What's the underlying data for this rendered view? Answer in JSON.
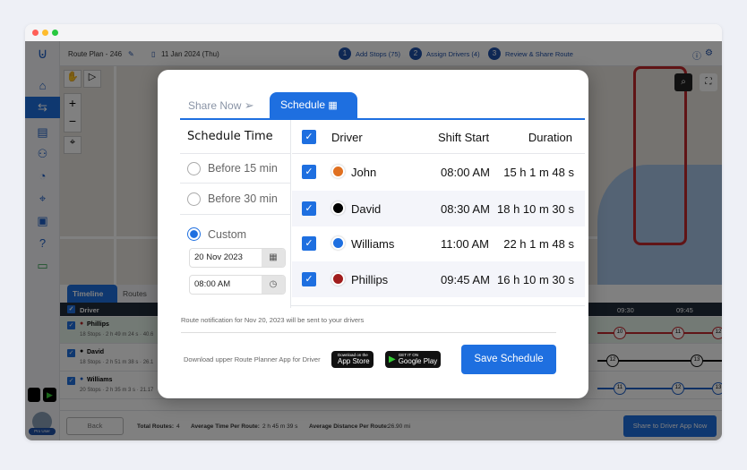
{
  "header": {
    "plan": "Route Plan - 246",
    "date": "11 Jan 2024 (Thu)",
    "steps": [
      {
        "n": "1",
        "label": "Add Stops (75)"
      },
      {
        "n": "2",
        "label": "Assign Drivers (4)"
      },
      {
        "n": "3",
        "label": "Review & Share Route"
      }
    ]
  },
  "timeline": {
    "tabs": [
      "Timeline",
      "Routes"
    ],
    "driver_header": "Driver",
    "times": [
      "09:30",
      "09:45"
    ],
    "drivers": [
      {
        "name": "Phillips",
        "color": "#b22222",
        "meta": "18 Stops · 2 h 49 m 24 s · 40.6"
      },
      {
        "name": "David",
        "color": "#000000",
        "meta": "18 Stops · 2 h 51 m 38 s · 26.1"
      },
      {
        "name": "Williams",
        "color": "#1e5fc7",
        "meta": "20 Stops · 2 h 35 m 3 s · 21.17"
      }
    ],
    "stops": [
      [
        "10",
        "11",
        "12"
      ],
      [
        "12",
        "13"
      ],
      [
        "11",
        "12",
        "13"
      ]
    ]
  },
  "footer": {
    "back": "Back",
    "total_label": "Total Routes:",
    "total": "4",
    "avg_time_label": "Average Time Per Route:",
    "avg_time": "2 h 45 m 39 s",
    "avg_dist_label": "Average Distance Per Route:",
    "avg_dist": "26.90 mi",
    "share": "Share to Driver App Now",
    "user": "Pro User"
  },
  "modal": {
    "tabs": {
      "share_now": "Share Now",
      "schedule": "Schedule"
    },
    "schedule_time": "Schedule Time",
    "options": [
      "Before 15 min",
      "Before 30 min",
      "Custom"
    ],
    "selected": "Custom",
    "custom_date": "20 Nov 2023",
    "custom_time": "08:00 AM",
    "columns": [
      "Driver",
      "Shift Start",
      "Duration"
    ],
    "rows": [
      {
        "driver": "John",
        "color": "#e07020",
        "shift": "08:00 AM",
        "duration": "15 h 1 m 48 s"
      },
      {
        "driver": "David",
        "color": "#000000",
        "shift": "08:30 AM",
        "duration": "18 h 10 m 30 s"
      },
      {
        "driver": "Williams",
        "color": "#1e6fe0",
        "shift": "11:00 AM",
        "duration": "22 h 1 m 48 s"
      },
      {
        "driver": "Phillips",
        "color": "#a01c1c",
        "shift": "09:45 AM",
        "duration": "16 h 10 m 30 s"
      }
    ],
    "notice": "Route notification for Nov 20, 2023 will be sent to your drivers",
    "download": "Download upper Route Planner App for Driver",
    "app_store": "App Store",
    "app_store_small": "Download on the",
    "google_play": "Google Play",
    "google_play_small": "GET IT ON",
    "save": "Save Schedule"
  },
  "colors": {
    "accent": "#1e6fe0"
  }
}
